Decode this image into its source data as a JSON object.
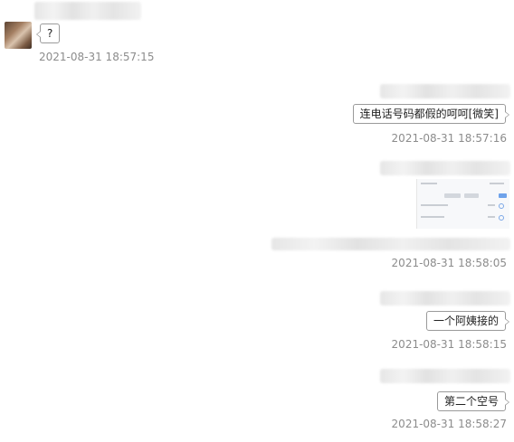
{
  "messages": [
    {
      "side": "left",
      "text": "?",
      "time": "2021-08-31 18:57:15",
      "avatar_icon": "user-avatar"
    },
    {
      "side": "right",
      "text": "连电话号码都假的呵呵[微笑]",
      "time": "2021-08-31 18:57:16"
    },
    {
      "side": "right",
      "type": "image",
      "image_icon": "phone-screenshot-image",
      "time": "2021-08-31 18:58:05"
    },
    {
      "side": "right",
      "text": "一个阿姨接的",
      "time": "2021-08-31 18:58:15"
    },
    {
      "side": "right",
      "text": "第二个空号",
      "time": "2021-08-31 18:58:27"
    }
  ],
  "colors": {
    "background": "#ffffff",
    "bubble_border": "#9a9a9a",
    "timestamp": "#8c8c8c",
    "text": "#222222"
  }
}
